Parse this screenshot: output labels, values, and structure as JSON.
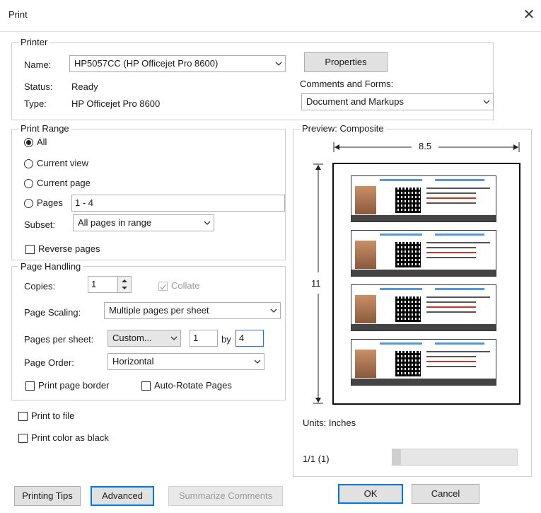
{
  "window": {
    "title": "Print",
    "close_glyph": "✕"
  },
  "printer": {
    "legend": "Printer",
    "name_label": "Name:",
    "name_value": "HP5057CC (HP Officejet Pro 8600)",
    "status_label": "Status:",
    "status_value": "Ready",
    "type_label": "Type:",
    "type_value": "HP Officejet Pro 8600",
    "properties_button": "Properties",
    "comments_label": "Comments and Forms:",
    "comments_value": "Document and Markups"
  },
  "print_range": {
    "legend": "Print Range",
    "options": {
      "all": "All",
      "current_view": "Current view",
      "current_page": "Current page",
      "pages": "Pages"
    },
    "selected": "all",
    "pages_value": "1 - 4",
    "subset_label": "Subset:",
    "subset_value": "All pages in range",
    "reverse_label": "Reverse pages"
  },
  "page_handling": {
    "legend": "Page Handling",
    "copies_label": "Copies:",
    "copies_value": "1",
    "collate_label": "Collate",
    "scaling_label": "Page Scaling:",
    "scaling_value": "Multiple pages per sheet",
    "pps_label": "Pages per sheet:",
    "pps_value": "Custom...",
    "pps_cols": "1",
    "by_label": "by",
    "pps_rows": "4",
    "order_label": "Page Order:",
    "order_value": "Horizontal",
    "border_label": "Print page border",
    "autorotate_label": "Auto-Rotate Pages"
  },
  "options": {
    "print_to_file": "Print to file",
    "print_color_black": "Print color as black"
  },
  "preview": {
    "legend": "Preview: Composite",
    "width_label": "8.5",
    "height_label": "11",
    "units_label": "Units: Inches",
    "page_counter": "1/1 (1)",
    "card_count": 4
  },
  "footer": {
    "printing_tips": "Printing Tips",
    "advanced": "Advanced",
    "summarize": "Summarize Comments",
    "ok": "OK",
    "cancel": "Cancel"
  },
  "colors": {
    "accent": "#0078d7",
    "card_footer": "#444444",
    "card_header_text": "#2a7fd4",
    "warning_text": "#c0392b"
  }
}
